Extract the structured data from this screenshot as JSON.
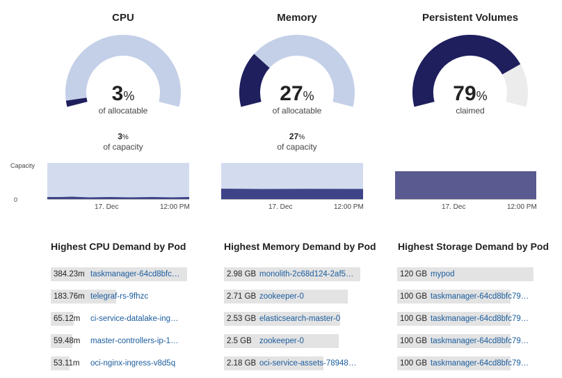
{
  "colors": {
    "gauge_fill": "#1f1f5e",
    "gauge_empty_blue": "#c4d0e8",
    "gauge_empty_gray": "#ececec",
    "spark_light": "#d3dcef",
    "spark_dark": "#3f4488",
    "spark_pv": "#5a5a90",
    "link": "#1a5c9e"
  },
  "cpu": {
    "title": "CPU",
    "percent": "3",
    "unit": "%",
    "gauge_label": "of allocatable",
    "capacity_percent": "3",
    "capacity_unit": "%",
    "capacity_label": "of capacity",
    "fraction": 0.03
  },
  "memory": {
    "title": "Memory",
    "percent": "27",
    "unit": "%",
    "gauge_label": "of allocatable",
    "capacity_percent": "27",
    "capacity_unit": "%",
    "capacity_label": "of capacity",
    "fraction": 0.27
  },
  "pv": {
    "title": "Persistent Volumes",
    "percent": "79",
    "unit": "%",
    "gauge_label": "claimed",
    "fraction": 0.79
  },
  "sparkline": {
    "y_top_label": "Capacity",
    "y_bottom_label": "0",
    "x_ticks": [
      "17. Dec",
      "12:00 PM"
    ]
  },
  "cpu_list": {
    "title": "Highest CPU Demand by Pod",
    "rows": [
      {
        "value": "384.23m",
        "name": "taskmanager-64cd8bfc…",
        "bar": 1.0
      },
      {
        "value": "183.76m",
        "name": "telegraf-rs-9fhzc",
        "bar": 0.48
      },
      {
        "value": "65.12m",
        "name": "ci-service-datalake-ing…",
        "bar": 0.17
      },
      {
        "value": "59.48m",
        "name": "master-controllers-ip-1…",
        "bar": 0.16
      },
      {
        "value": "53.11m",
        "name": "oci-nginx-ingress-v8d5q",
        "bar": 0.14
      }
    ]
  },
  "memory_list": {
    "title": "Highest Memory Demand by Pod",
    "rows": [
      {
        "value": "2.98 GB",
        "name": "monolith-2c68d124-2af5…",
        "bar": 1.0
      },
      {
        "value": "2.71 GB",
        "name": "zookeeper-0",
        "bar": 0.91
      },
      {
        "value": "2.53 GB",
        "name": "elasticsearch-master-0",
        "bar": 0.85
      },
      {
        "value": "2.5 GB",
        "name": "zookeeper-0",
        "bar": 0.84
      },
      {
        "value": "2.18 GB",
        "name": "oci-service-assets-78948…",
        "bar": 0.73
      }
    ]
  },
  "storage_list": {
    "title": "Highest Storage Demand by Pod",
    "rows": [
      {
        "value": "120 GB",
        "name": "mypod",
        "bar": 1.0
      },
      {
        "value": "100 GB",
        "name": "taskmanager-64cd8bfc79…",
        "bar": 0.83
      },
      {
        "value": "100 GB",
        "name": "taskmanager-64cd8bfc79…",
        "bar": 0.83
      },
      {
        "value": "100 GB",
        "name": "taskmanager-64cd8bfc79…",
        "bar": 0.83
      },
      {
        "value": "100 GB",
        "name": "taskmanager-64cd8bfc79…",
        "bar": 0.83
      }
    ]
  }
}
